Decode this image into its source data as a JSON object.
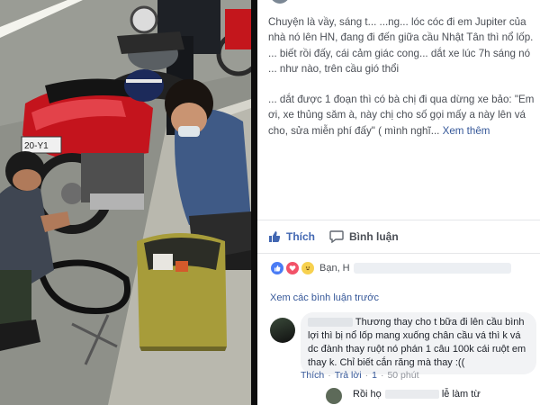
{
  "photo": {
    "plate_text": "20-Y1",
    "description_icon": "roadside-motorbike-repair-photo"
  },
  "post": {
    "paragraph1": "Chuyện là vầy, sáng t... ...ng... lóc cóc đi em Jupiter của nhà nó lên HN, đang đi đến giữa cầu Nhật Tân thì nổ lốp. ... biết rồi đấy, cái cảm giác cong... dắt xe lúc 7h sáng nó ... như nào, trên cầu gió thổi",
    "paragraph2": "... dắt được 1 đoạn thì có bà chị đi qua dừng xe bảo: \"Em ơi, xe thủng săm à, này chị cho số gọi mấy a này lên vá cho, sửa miễn phí đấy\" ( mình nghĩ...",
    "see_more": "Xem thêm"
  },
  "actions": {
    "like_label": "Thích",
    "comment_label": "Bình luận"
  },
  "reactions": {
    "names": "Bạn, H"
  },
  "comments": {
    "view_previous": "Xem các bình luận trước",
    "items": [
      {
        "text": "Thương thay cho t bữa đi lên cầu bình lợi thì bị nổ lốp mang xuống chân cầu vá thì k vá dc đành thay ruột nó phán 1 câu 100k cái ruột em thay k. Chỉ biết cắn răng mà thay :((",
        "like": "Thích",
        "reply": "Trả lời",
        "count": "1",
        "time": "50 phút"
      }
    ],
    "reply_preview": "Rồi họ",
    "reply_tail": "lễ làm từ"
  },
  "colors": {
    "link": "#365899",
    "like_blue": "#4267b2",
    "bubble": "#f2f3f5"
  }
}
